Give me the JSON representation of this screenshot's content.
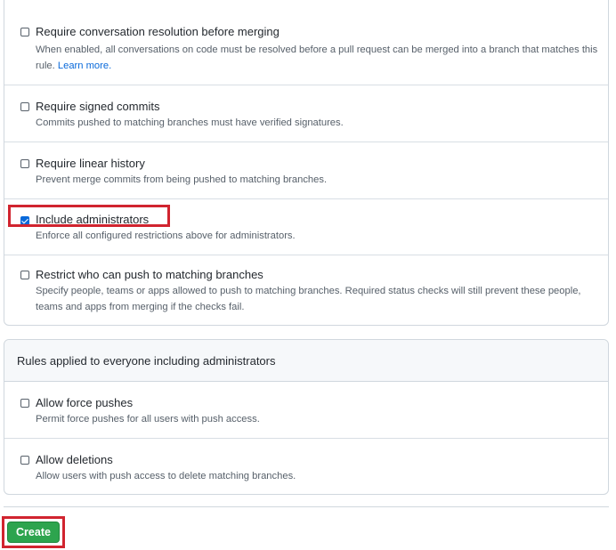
{
  "protections": [
    {
      "label": "Require conversation resolution before merging",
      "checked": false,
      "description": "When enabled, all conversations on code must be resolved before a pull request can be merged into a branch that matches this rule.",
      "link": "Learn more."
    },
    {
      "label": "Require signed commits",
      "checked": false,
      "description": "Commits pushed to matching branches must have verified signatures."
    },
    {
      "label": "Require linear history",
      "checked": false,
      "description": "Prevent merge commits from being pushed to matching branches."
    },
    {
      "label": "Include administrators",
      "checked": true,
      "description": "Enforce all configured restrictions above for administrators."
    },
    {
      "label": "Restrict who can push to matching branches",
      "checked": false,
      "description": "Specify people, teams or apps allowed to push to matching branches. Required status checks will still prevent these people, teams and apps from merging if the checks fail."
    }
  ],
  "everyone_rules": {
    "title": "Rules applied to everyone including administrators",
    "items": [
      {
        "label": "Allow force pushes",
        "checked": false,
        "description": "Permit force pushes for all users with push access."
      },
      {
        "label": "Allow deletions",
        "checked": false,
        "description": "Allow users with push access to delete matching branches."
      }
    ]
  },
  "actions": {
    "create_label": "Create"
  },
  "colors": {
    "highlight": "#d1242f",
    "primary_button": "#2da44e",
    "link": "#0969da",
    "checkbox_checked": "#0969da"
  }
}
